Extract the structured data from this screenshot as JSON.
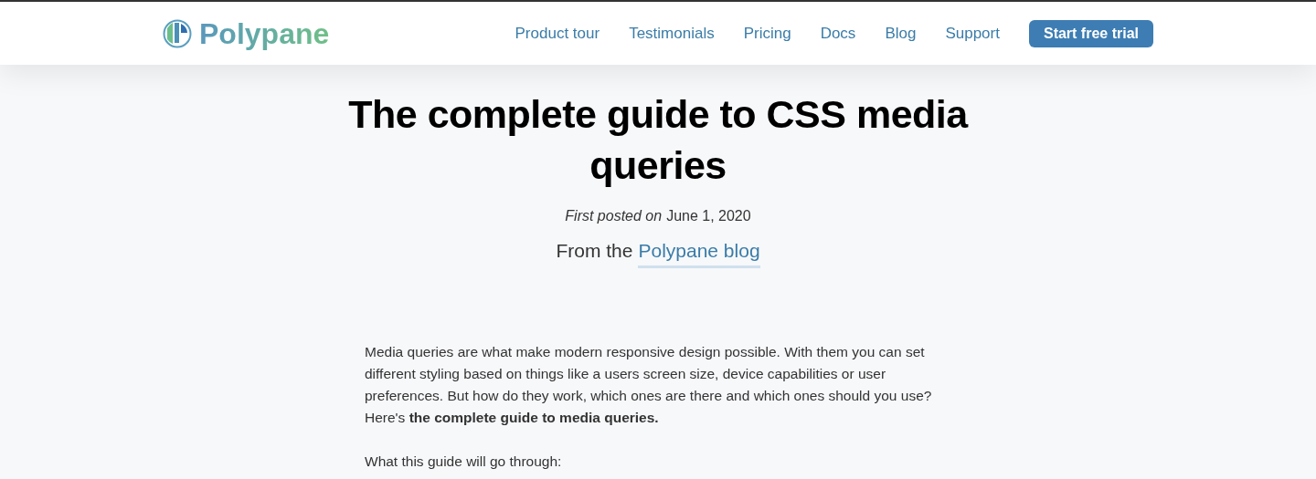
{
  "header": {
    "brand": "Polypane",
    "nav": [
      {
        "label": "Product tour"
      },
      {
        "label": "Testimonials"
      },
      {
        "label": "Pricing"
      },
      {
        "label": "Docs"
      },
      {
        "label": "Blog"
      },
      {
        "label": "Support"
      }
    ],
    "cta": "Start free trial"
  },
  "article": {
    "title": "The complete guide to CSS media queries",
    "posted_label": "First posted on",
    "posted_date": "June 1, 2020",
    "source_prefix": "From the",
    "source_link": "Polypane blog",
    "paragraphs": [
      "Media queries are what make modern responsive design possible. With them you can set different styling based on things like a users screen size, device capabilities or user preferences. But how do they work, which ones are there and which ones should you use? Here's **the complete guide to media queries.**",
      "What this guide will go through:"
    ]
  }
}
